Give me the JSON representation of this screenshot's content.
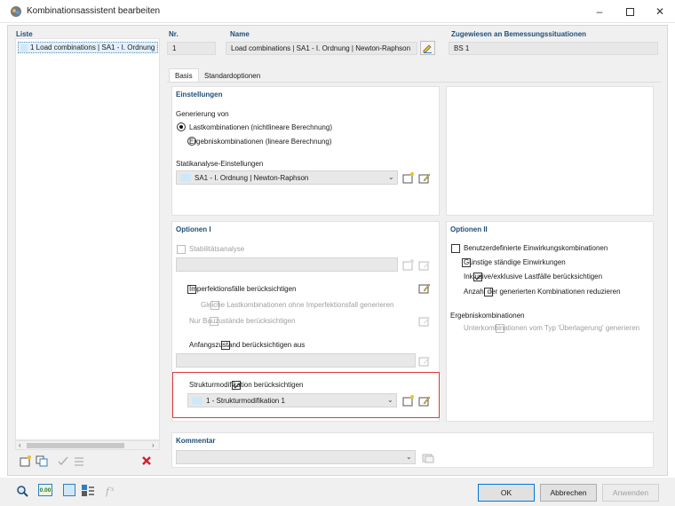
{
  "window": {
    "title": "Kombinationsassistent bearbeiten"
  },
  "list": {
    "header": "Liste",
    "items": [
      {
        "label": "1  Load combinations | SA1 - I. Ordnung"
      }
    ]
  },
  "header": {
    "nr_label": "Nr.",
    "nr_value": "1",
    "name_label": "Name",
    "name_value": "Load combinations | SA1 - I. Ordnung | Newton-Raphson",
    "assigned_label": "Zugewiesen an Bemessungssituationen",
    "assigned_value": "BS 1"
  },
  "tabs": [
    {
      "label": "Basis"
    },
    {
      "label": "Standardoptionen"
    }
  ],
  "einstellungen": {
    "title": "Einstellungen",
    "generation_label": "Generierung von",
    "radio_1": "Lastkombinationen (nichtlineare Berechnung)",
    "radio_2": "Ergebniskombinationen (lineare Berechnung)",
    "static_label": "Statikanalyse-Einstellungen",
    "static_value": "SA1 - I. Ordnung | Newton-Raphson"
  },
  "optionen1": {
    "title": "Optionen I",
    "stability": "Stabilitätsanalyse",
    "imperfection": "Imperfektionsfälle berücksichtigen",
    "same_lc": "Gleiche Lastkombinationen ohne Imperfektionsfall generieren",
    "construction_stages": "Nur Bauzustände berücksichtigen",
    "initial_state": "Anfangszustand berücksichtigen aus",
    "structure_mod": "Strukturmodifikation berücksichtigen",
    "structure_mod_value": "1 - Strukturmodifikation 1"
  },
  "optionen2": {
    "title": "Optionen II",
    "opt1": "Benutzerdefinierte Einwirkungskombinationen",
    "opt2": "Günstige ständige Einwirkungen",
    "opt3": "Inklusive/exklusive Lastfälle berücksichtigen",
    "opt4": "Anzahl der generierten Kombinationen reduzieren",
    "result_label": "Ergebniskombinationen",
    "result_opt": "Unterkombinationen vom Typ 'Überlagerung' generieren"
  },
  "kommentar": {
    "title": "Kommentar"
  },
  "buttons": {
    "ok": "OK",
    "cancel": "Abbrechen",
    "apply": "Anwenden"
  },
  "bottom_toolbar": {
    "value_label": "0.00"
  },
  "colors": {
    "accent_blue": "#1f4e79",
    "highlight_red": "#e0393e",
    "swatch": "#cfe8f7"
  }
}
